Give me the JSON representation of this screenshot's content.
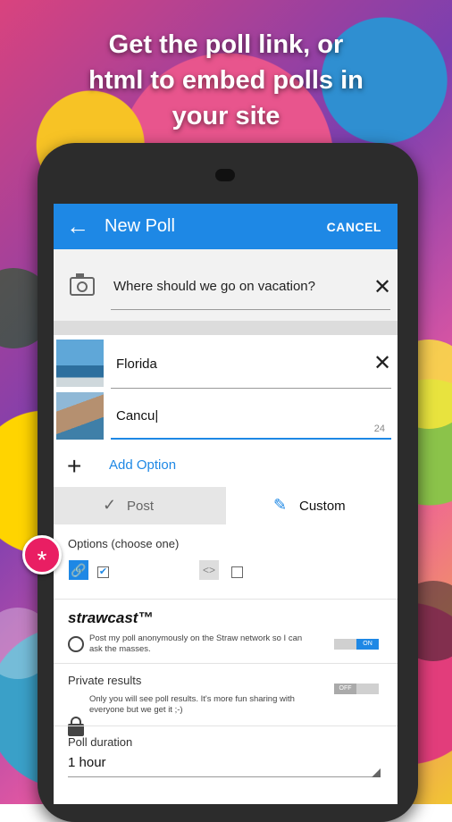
{
  "headline": [
    "Get the poll link, or",
    "html to embed polls in",
    "your site"
  ],
  "appbar": {
    "title": "New Poll",
    "cancel": "CANCEL"
  },
  "question": {
    "text": "Where should we go on vacation?"
  },
  "options": [
    {
      "text": "Florida"
    },
    {
      "text": "Cancu|",
      "char_count": "24"
    }
  ],
  "add_option": "Add Option",
  "tabs": {
    "post": "Post",
    "custom": "Custom"
  },
  "custom": {
    "options_label": "Options (choose one)",
    "brand": "strawcast™",
    "anon_text": "Post my poll anonymously on the Straw network so I can ask the masses.",
    "anon_toggle": "ON",
    "private_label": "Private results",
    "private_text": "Only you will see poll results. It's more fun sharing with everyone but we get it ;-)",
    "private_toggle": "OFF",
    "duration_label": "Poll duration",
    "duration_value": "1 hour"
  },
  "fab": "*",
  "colors": {
    "accent": "#1e88e5",
    "fab": "#e91e63"
  }
}
